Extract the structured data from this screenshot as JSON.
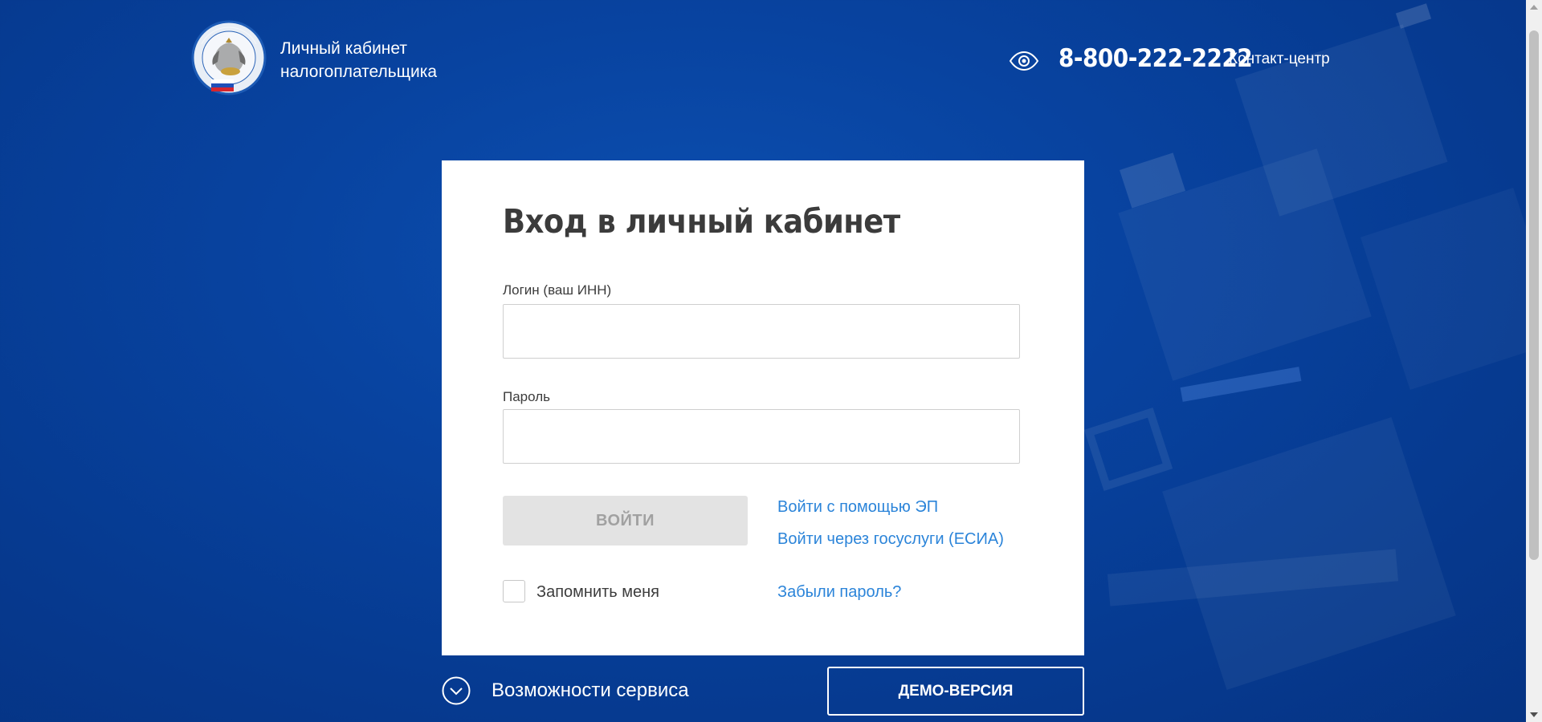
{
  "header": {
    "brand_line1": "Личный кабинет",
    "brand_line2": "налогоплательщика",
    "phone": "8-800-222-2222",
    "contact_label": "Контакт-центр"
  },
  "login_card": {
    "title": "Вход в личный кабинет",
    "login_label": "Логин (ваш ИНН)",
    "login_value": "",
    "password_label": "Пароль",
    "password_value": "",
    "submit_label": "ВОЙТИ",
    "link_ep": "Войти с помощью ЭП",
    "link_esia": "Войти через госуслуги (ЕСИА)",
    "remember_label": "Запомнить меня",
    "remember_checked": false,
    "forgot_link": "Забыли пароль?"
  },
  "footer": {
    "features_label": "Возможности сервиса",
    "demo_label": "ДЕМО-ВЕРСИЯ"
  },
  "icons": {
    "logo": "fns-emblem-icon",
    "accessibility": "eye-icon",
    "features": "chevron-down-circle-icon"
  },
  "colors": {
    "background": "#0843a0",
    "link": "#2b84d9",
    "button_disabled_bg": "#e3e3e3",
    "button_disabled_text": "#a1a1a1",
    "title_text": "#3b3b3b"
  }
}
